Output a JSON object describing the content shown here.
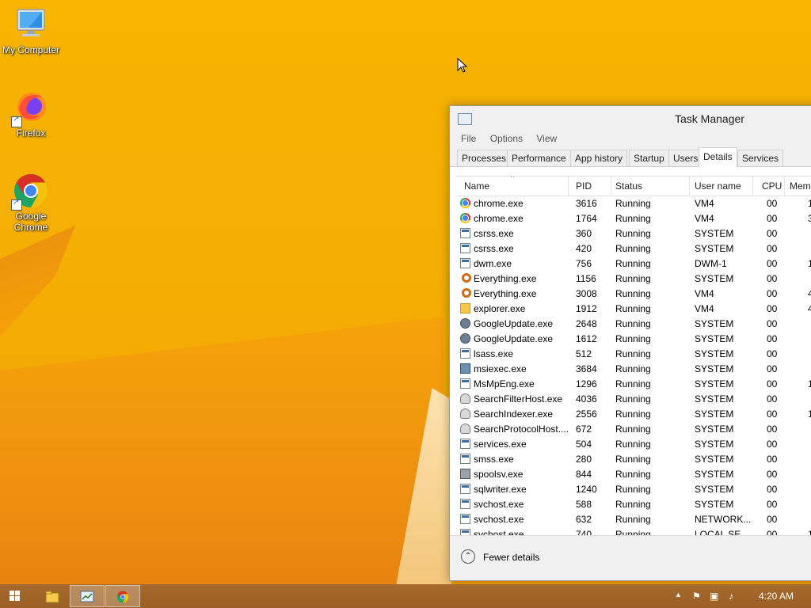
{
  "desktop": {
    "icons": [
      {
        "label": "My Computer",
        "icon": "computer-icon"
      },
      {
        "label": "Firefox",
        "icon": "firefox-icon"
      },
      {
        "label": "Google Chrome",
        "icon": "chrome-icon"
      }
    ]
  },
  "taskmanager": {
    "title": "Task Manager",
    "menu": [
      "File",
      "Options",
      "View"
    ],
    "tabs": [
      "Processes",
      "Performance",
      "App history",
      "Startup",
      "Users",
      "Details",
      "Services"
    ],
    "active_tab": "Details",
    "columns": [
      "Name",
      "PID",
      "Status",
      "User name",
      "CPU",
      "Mem"
    ],
    "rows": [
      {
        "name": "chrome.exe",
        "pid": "3616",
        "status": "Running",
        "user": "VM4",
        "cpu": "00",
        "mem": "1",
        "icon": "chrome"
      },
      {
        "name": "chrome.exe",
        "pid": "1764",
        "status": "Running",
        "user": "VM4",
        "cpu": "00",
        "mem": "3",
        "icon": "chrome"
      },
      {
        "name": "csrss.exe",
        "pid": "360",
        "status": "Running",
        "user": "SYSTEM",
        "cpu": "00",
        "mem": "",
        "icon": "win"
      },
      {
        "name": "csrss.exe",
        "pid": "420",
        "status": "Running",
        "user": "SYSTEM",
        "cpu": "00",
        "mem": "",
        "icon": "win"
      },
      {
        "name": "dwm.exe",
        "pid": "756",
        "status": "Running",
        "user": "DWM-1",
        "cpu": "00",
        "mem": "1",
        "icon": "win"
      },
      {
        "name": "Everything.exe",
        "pid": "1156",
        "status": "Running",
        "user": "SYSTEM",
        "cpu": "00",
        "mem": "",
        "icon": "key"
      },
      {
        "name": "Everything.exe",
        "pid": "3008",
        "status": "Running",
        "user": "VM4",
        "cpu": "00",
        "mem": "4",
        "icon": "key"
      },
      {
        "name": "explorer.exe",
        "pid": "1912",
        "status": "Running",
        "user": "VM4",
        "cpu": "00",
        "mem": "4",
        "icon": "folder"
      },
      {
        "name": "GoogleUpdate.exe",
        "pid": "2648",
        "status": "Running",
        "user": "SYSTEM",
        "cpu": "00",
        "mem": "",
        "icon": "gear"
      },
      {
        "name": "GoogleUpdate.exe",
        "pid": "1612",
        "status": "Running",
        "user": "SYSTEM",
        "cpu": "00",
        "mem": "",
        "icon": "gear"
      },
      {
        "name": "lsass.exe",
        "pid": "512",
        "status": "Running",
        "user": "SYSTEM",
        "cpu": "00",
        "mem": "",
        "icon": "win"
      },
      {
        "name": "msiexec.exe",
        "pid": "3684",
        "status": "Running",
        "user": "SYSTEM",
        "cpu": "00",
        "mem": "",
        "icon": "pkg"
      },
      {
        "name": "MsMpEng.exe",
        "pid": "1296",
        "status": "Running",
        "user": "SYSTEM",
        "cpu": "00",
        "mem": "1",
        "icon": "win"
      },
      {
        "name": "SearchFilterHost.exe",
        "pid": "4036",
        "status": "Running",
        "user": "SYSTEM",
        "cpu": "00",
        "mem": "",
        "icon": "user"
      },
      {
        "name": "SearchIndexer.exe",
        "pid": "2556",
        "status": "Running",
        "user": "SYSTEM",
        "cpu": "00",
        "mem": "1",
        "icon": "user"
      },
      {
        "name": "SearchProtocolHost....",
        "pid": "672",
        "status": "Running",
        "user": "SYSTEM",
        "cpu": "00",
        "mem": "",
        "icon": "user"
      },
      {
        "name": "services.exe",
        "pid": "504",
        "status": "Running",
        "user": "SYSTEM",
        "cpu": "00",
        "mem": "",
        "icon": "win"
      },
      {
        "name": "smss.exe",
        "pid": "280",
        "status": "Running",
        "user": "SYSTEM",
        "cpu": "00",
        "mem": "",
        "icon": "win"
      },
      {
        "name": "spoolsv.exe",
        "pid": "844",
        "status": "Running",
        "user": "SYSTEM",
        "cpu": "00",
        "mem": "",
        "icon": "printer"
      },
      {
        "name": "sqlwriter.exe",
        "pid": "1240",
        "status": "Running",
        "user": "SYSTEM",
        "cpu": "00",
        "mem": "",
        "icon": "win"
      },
      {
        "name": "svchost.exe",
        "pid": "588",
        "status": "Running",
        "user": "SYSTEM",
        "cpu": "00",
        "mem": "",
        "icon": "win"
      },
      {
        "name": "svchost.exe",
        "pid": "632",
        "status": "Running",
        "user": "NETWORK...",
        "cpu": "00",
        "mem": "",
        "icon": "win"
      },
      {
        "name": "svchost.exe",
        "pid": "740",
        "status": "Running",
        "user": "LOCAL SE...",
        "cpu": "00",
        "mem": "1",
        "icon": "win"
      }
    ],
    "fewer_details": "Fewer details"
  },
  "taskbar": {
    "clock": "4:20 AM",
    "items": [
      "start-button",
      "file-explorer",
      "task-manager",
      "chrome"
    ]
  }
}
